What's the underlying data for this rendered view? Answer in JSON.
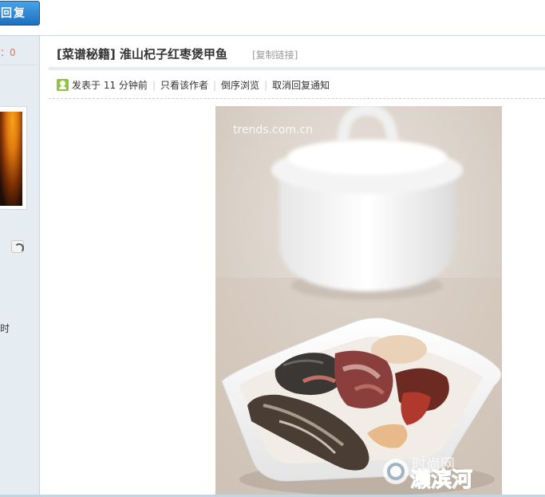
{
  "toolbar": {
    "reply_label": "回复"
  },
  "sidebar": {
    "stat_colon": "：",
    "stat_value": "0",
    "partial_text": "时"
  },
  "post": {
    "tag": "[菜谱秘籍]",
    "title": "淮山杞子红枣煲甲鱼",
    "copy_link": "[复制链接]",
    "meta": {
      "posted_prefix": "发表于",
      "posted_time": "11 分钟前",
      "author_only": "只看该作者",
      "reverse_order": "倒序浏览",
      "cancel_notify": "取消回复通知"
    }
  },
  "image": {
    "watermark_top": "trends.com.cn",
    "watermark_bottom_grey": "时尚网",
    "watermark_bottom_blue": "濑滨河"
  },
  "colors": {
    "accent_blue": "#1c6fbf",
    "sidebar_bg": "#e5edf2",
    "stat_orange": "#f26c4f",
    "icon_green": "#8cc63f"
  }
}
